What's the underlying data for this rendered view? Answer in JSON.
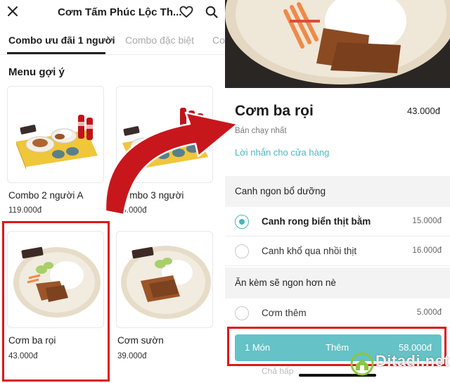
{
  "left_screen": {
    "header": {
      "title": "Cơm Tấm Phúc Lộc Th...",
      "close_icon": "close-icon",
      "favorite_icon": "heart-icon",
      "search_icon": "search-icon"
    },
    "tabs": [
      {
        "label": "Combo ưu đãi 1 người",
        "active": true
      },
      {
        "label": "Combo đặc biệt",
        "active": false
      },
      {
        "label": "Co",
        "active": false
      }
    ],
    "section_title": "Menu gợi ý",
    "items": [
      {
        "name": "Combo 2 người A",
        "price": "119.000đ"
      },
      {
        "name": "Combo 3 người",
        "price": "86.000đ"
      },
      {
        "name": "Cơm ba rọi",
        "price": "43.000đ"
      },
      {
        "name": "Cơm sườn",
        "price": "39.000đ"
      }
    ]
  },
  "right_screen": {
    "dish": {
      "title": "Cơm ba rọi",
      "price": "43.000đ",
      "badge": "Bán chạy nhất",
      "note_link": "Lời nhắn cho cửa hàng"
    },
    "groups": [
      {
        "title": "Canh ngon bổ dưỡng",
        "options": [
          {
            "label": "Canh rong biển thịt bằm",
            "price": "15.000đ",
            "selected": true
          },
          {
            "label": "Canh khổ qua nhồi thịt",
            "price": "16.000đ",
            "selected": false
          }
        ]
      },
      {
        "title": "Ăn kèm sẽ ngon hơn nè",
        "options": [
          {
            "label": "Cơm thêm",
            "price": "5.000đ",
            "selected": false
          }
        ]
      }
    ],
    "cart_button": {
      "quantity": "1 Món",
      "action": "Thêm",
      "total": "58.000đ"
    },
    "under_row_text": "Chả hấp"
  },
  "watermark": "Ditadi.net",
  "colors": {
    "accent": "#4bb5bb",
    "highlight": "#e0161b",
    "arrow": "#c8171c"
  }
}
